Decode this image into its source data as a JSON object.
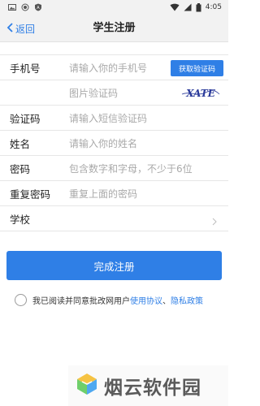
{
  "status_bar": {
    "time": "4:05",
    "left_icons": [
      "photo-icon",
      "record-icon",
      "shield-icon"
    ],
    "right_icons": [
      "wifi-icon",
      "signal-icon",
      "battery-icon"
    ]
  },
  "header": {
    "back_label": "返回",
    "title": "学生注册"
  },
  "form": {
    "rows": [
      {
        "label": "手机号",
        "placeholder": "请输入你的手机号",
        "button": "获取验证码"
      },
      {
        "label": "",
        "placeholder": "图片验证码",
        "captcha_text": "XATE"
      },
      {
        "label": "验证码",
        "placeholder": "请输入短信验证码"
      },
      {
        "label": "姓名",
        "placeholder": "请输入你的姓名"
      },
      {
        "label": "密码",
        "placeholder": "包含数字和字母，不少于6位"
      },
      {
        "label": "重复密码",
        "placeholder": "重复上面的密码"
      },
      {
        "label": "学校",
        "placeholder": ""
      }
    ]
  },
  "submit": {
    "label": "完成注册"
  },
  "agreement": {
    "text": "我已阅读并同意批改网用户",
    "link1": "使用协议",
    "separator": "、",
    "link2": "隐私政策"
  },
  "watermark": {
    "text": "烟云软件园"
  },
  "colors": {
    "accent": "#2f7fe6",
    "background": "#ffffff",
    "bar": "#f2f2f2"
  }
}
